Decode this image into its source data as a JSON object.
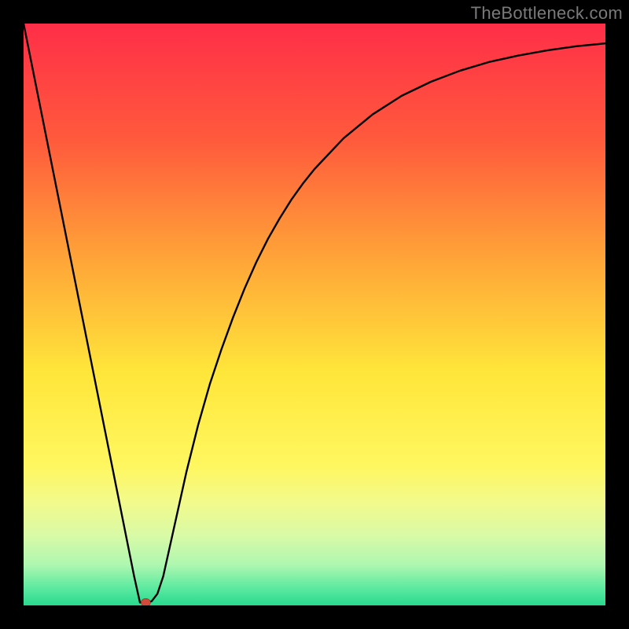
{
  "watermark": "TheBottleneck.com",
  "chart_data": {
    "type": "line",
    "title": "",
    "xlabel": "",
    "ylabel": "",
    "xlim": [
      0,
      100
    ],
    "ylim": [
      0,
      100
    ],
    "x": [
      0,
      2,
      4,
      6,
      8,
      10,
      12,
      14,
      16,
      18,
      19,
      20,
      21,
      22,
      23,
      24,
      26,
      28,
      30,
      32,
      34,
      36,
      38,
      40,
      42,
      44,
      46,
      48,
      50,
      55,
      60,
      65,
      70,
      75,
      80,
      85,
      90,
      95,
      100
    ],
    "values": [
      100,
      90,
      80,
      70,
      60,
      50,
      40,
      30,
      20,
      10,
      5,
      0.5,
      0.5,
      0.7,
      2,
      5,
      14,
      23,
      31,
      38,
      44,
      49.5,
      54.5,
      59,
      63,
      66.5,
      69.7,
      72.5,
      75,
      80.3,
      84.4,
      87.6,
      90,
      91.9,
      93.4,
      94.5,
      95.4,
      96.1,
      96.6
    ],
    "marker": {
      "x": 21,
      "y": 0.5,
      "color": "#d14a3a"
    },
    "background_gradient": {
      "stops": [
        {
          "offset": 0.0,
          "color": "#ff2e48"
        },
        {
          "offset": 0.2,
          "color": "#ff5a3c"
        },
        {
          "offset": 0.4,
          "color": "#ffa338"
        },
        {
          "offset": 0.6,
          "color": "#ffe63a"
        },
        {
          "offset": 0.76,
          "color": "#fff760"
        },
        {
          "offset": 0.82,
          "color": "#f3fa8a"
        },
        {
          "offset": 0.88,
          "color": "#d9faa6"
        },
        {
          "offset": 0.93,
          "color": "#aef7b0"
        },
        {
          "offset": 0.97,
          "color": "#5ceaa0"
        },
        {
          "offset": 1.0,
          "color": "#28d98f"
        }
      ]
    }
  }
}
